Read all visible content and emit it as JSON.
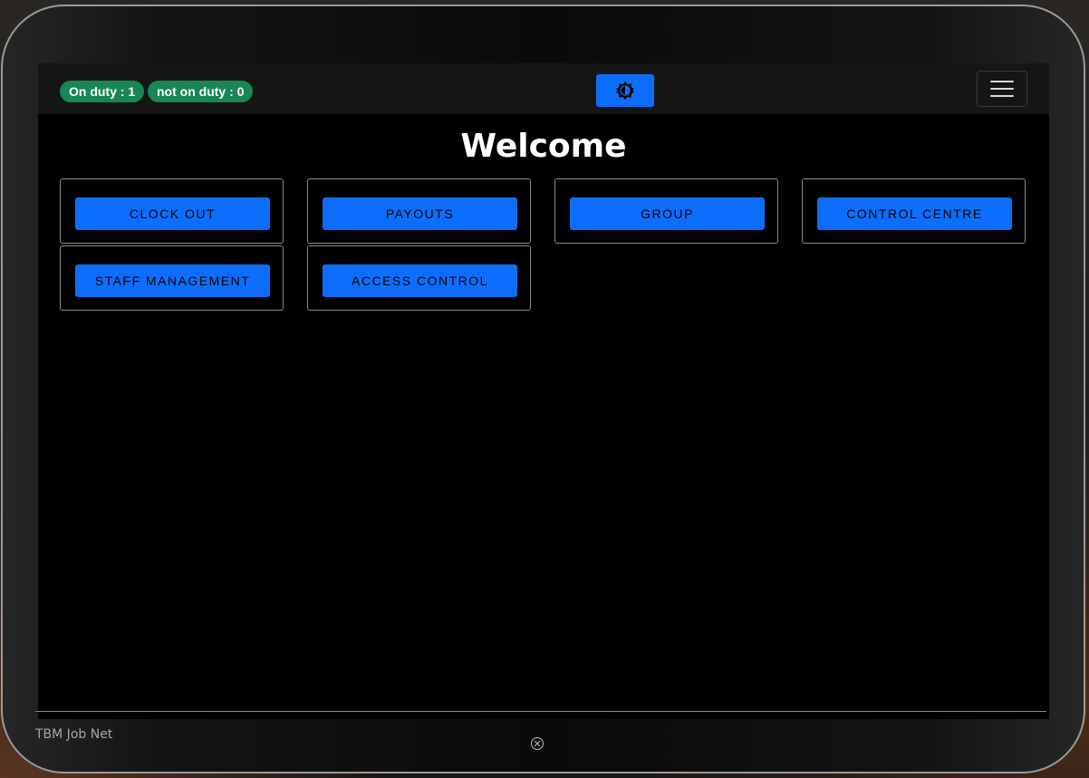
{
  "navbar": {
    "on_duty": "On duty : 1",
    "not_on_duty": "not on duty : 0",
    "theme_toggle_icon": "brightness-icon",
    "menu_icon": "hamburger-icon"
  },
  "main": {
    "title": "Welcome",
    "buttons": [
      {
        "label": "CLOCK OUT"
      },
      {
        "label": "PAYOUTS"
      },
      {
        "label": "GROUP"
      },
      {
        "label": "CONTROL CENTRE"
      },
      {
        "label": "STAFF MANAGEMENT"
      },
      {
        "label": "ACCESS CONTROL"
      }
    ]
  },
  "footer": {
    "text": "TBM Job Net",
    "close_icon": "close-circle-icon"
  },
  "colors": {
    "accent": "#0d6efd",
    "badge": "#198754",
    "background": "#000000"
  }
}
